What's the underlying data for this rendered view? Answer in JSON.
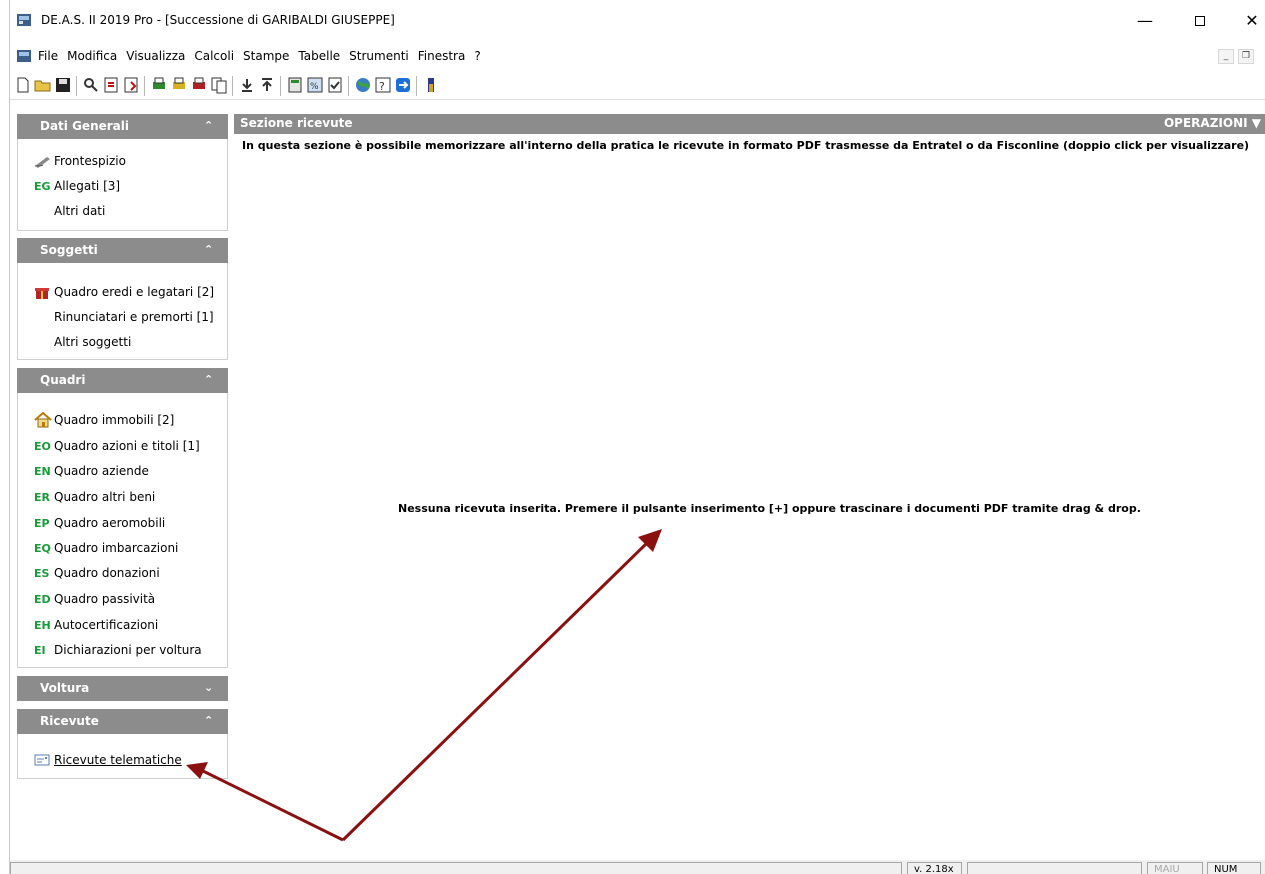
{
  "window": {
    "title": "DE.A.S. II 2019 Pro - [Successione di GARIBALDI GIUSEPPE]",
    "controls": {
      "minimize": "—",
      "close": "✕"
    }
  },
  "menu": [
    "File",
    "Modifica",
    "Visualizza",
    "Calcoli",
    "Stampe",
    "Tabelle",
    "Strumenti",
    "Finestra",
    "?"
  ],
  "toolbar": {
    "icons": [
      "new-document-icon",
      "open-folder-icon",
      "save-icon",
      "find-icon",
      "import-icon",
      "export-icon",
      "print-icon",
      "print-preview-icon",
      "printer-icon",
      "copy-pages-icon",
      "download-icon",
      "upload-icon",
      "calculator-icon",
      "percent-icon",
      "checklist-icon",
      "web-icon",
      "help-icon",
      "teamviewer-icon",
      "thermometer-icon"
    ]
  },
  "sidebar": {
    "groups": [
      {
        "title": "Dati Generali",
        "expanded": true,
        "items": [
          {
            "code": "",
            "icon": "signature-pen-icon",
            "label": "Frontespizio"
          },
          {
            "code": "EG",
            "label": "Allegati [3]"
          },
          {
            "code": "",
            "label": "Altri dati"
          }
        ]
      },
      {
        "title": "Soggetti",
        "expanded": true,
        "items": [
          {
            "code": "",
            "icon": "gift-icon",
            "label": "Quadro eredi e legatari [2]"
          },
          {
            "code": "",
            "label": "Rinunciatari e premorti [1]"
          },
          {
            "code": "",
            "label": "Altri soggetti"
          }
        ]
      },
      {
        "title": "Quadri",
        "expanded": true,
        "items": [
          {
            "code": "",
            "icon": "house-icon",
            "label": "Quadro immobili [2]"
          },
          {
            "code": "EO",
            "label": "Quadro azioni e titoli [1]"
          },
          {
            "code": "EN",
            "label": "Quadro aziende"
          },
          {
            "code": "ER",
            "label": "Quadro altri beni"
          },
          {
            "code": "EP",
            "label": "Quadro aeromobili"
          },
          {
            "code": "EQ",
            "label": "Quadro imbarcazioni"
          },
          {
            "code": "ES",
            "label": "Quadro donazioni"
          },
          {
            "code": "ED",
            "label": "Quadro passività"
          },
          {
            "code": "EH",
            "label": "Autocertificazioni"
          },
          {
            "code": "EI",
            "label": "Dichiarazioni per voltura"
          }
        ]
      },
      {
        "title": "Voltura",
        "expanded": false,
        "items": []
      },
      {
        "title": "Ricevute",
        "expanded": true,
        "items": [
          {
            "code": "",
            "icon": "receipt-icon",
            "label": "Ricevute telematiche"
          }
        ]
      }
    ],
    "chevron_up": "⌃",
    "chevron_down": "⌄"
  },
  "main": {
    "section_title": "Sezione ricevute",
    "operations_label": "OPERAZIONI ▼",
    "info": "In questa sezione è possibile memorizzare all'interno della pratica le ricevute in formato PDF trasmesse da Entratel o da Fisconline (doppio click per visualizzare)",
    "empty_message": "Nessuna ricevuta inserita. Premere il pulsante inserimento [+] oppure trascinare i documenti PDF tramite drag & drop."
  },
  "status": {
    "version": "v. 2.18x",
    "mail": "MAIU",
    "num": "NUM"
  },
  "colors": {
    "header_gray": "#8c8c8c",
    "code_green": "#1a9b3a",
    "arrow": "#8b1010"
  }
}
